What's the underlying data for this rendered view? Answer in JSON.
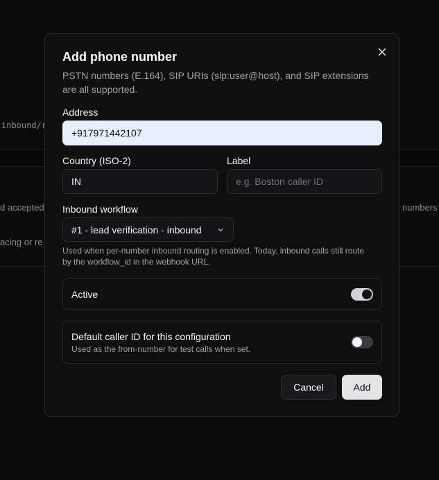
{
  "background": {
    "fragments": {
      "mono": "inbound/r",
      "left1": "d accepted",
      "right1": "numbers",
      "left2": "acing or re"
    }
  },
  "dialog": {
    "title": "Add phone number",
    "description": "PSTN numbers (E.164), SIP URIs (sip:user@host), and SIP extensions are all supported.",
    "close_icon": "close-icon",
    "address": {
      "label": "Address",
      "value": "+917971442107",
      "placeholder": ""
    },
    "country": {
      "label": "Country (ISO-2)",
      "value": "IN",
      "placeholder": ""
    },
    "label_field": {
      "label": "Label",
      "value": "",
      "placeholder": "e.g. Boston caller ID"
    },
    "inbound_workflow": {
      "label": "Inbound workflow",
      "selected": "#1 - lead verification - inbound",
      "icon": "chevron-down-icon",
      "hint": "Used when per-number inbound routing is enabled. Today, inbound calls still route by the workflow_id in the webhook URL."
    },
    "active": {
      "label": "Active",
      "on": true
    },
    "default_caller": {
      "label": "Default caller ID for this configuration",
      "sub": "Used as the from-number for test calls when set.",
      "on": false
    },
    "buttons": {
      "cancel": "Cancel",
      "add": "Add"
    }
  },
  "colors": {
    "accent_input": "#e8f0fe",
    "modal_bg": "#0f0f10",
    "border": "#2a2a2e"
  }
}
